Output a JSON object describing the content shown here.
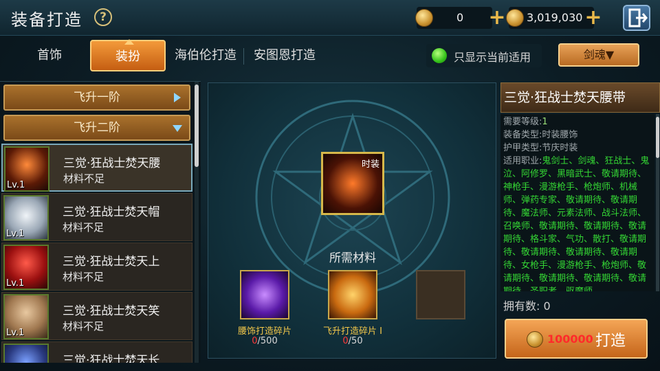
{
  "header": {
    "title": "装备打造",
    "currency1": "0",
    "currency2": "3,019,030"
  },
  "tabs": [
    "首饰",
    "装扮",
    "海伯伦打造",
    "安图恩打造"
  ],
  "filter": {
    "label": "只显示当前适用",
    "enabled": true
  },
  "class_select": "剑魂▼",
  "list": {
    "groups": [
      "飞升一阶",
      "飞升二阶"
    ],
    "items": [
      {
        "name": "三觉·狂战士焚天腰",
        "status": "材料不足",
        "lv": "Lv.1"
      },
      {
        "name": "三觉·狂战士焚天帽",
        "status": "材料不足",
        "lv": "Lv.1"
      },
      {
        "name": "三觉·狂战士焚天上",
        "status": "材料不足",
        "lv": "Lv.1"
      },
      {
        "name": "三觉·狂战士焚天笑",
        "status": "材料不足",
        "lv": "Lv.1"
      },
      {
        "name": "三觉·狂战士焚天长",
        "status": "",
        "lv": ""
      }
    ]
  },
  "center": {
    "result_tag": "时装",
    "req_label": "所需材料",
    "materials": [
      {
        "name": "腰饰打造碎片",
        "have": "0",
        "need": "/500"
      },
      {
        "name": "飞升打造碎片 I",
        "have": "0",
        "need": "/50"
      }
    ]
  },
  "info": {
    "title": "三觉·狂战士焚天腰带",
    "level_label": "需要等级:",
    "level_value": "1",
    "type_label": "装备类型:",
    "type_value": "时装腰饰",
    "armor_label": "护甲类型:",
    "armor_value": "节庆时装",
    "jobs_label": "适用职业:",
    "jobs_value": "鬼剑士、剑魂、狂战士、鬼泣、阿修罗、黑暗武士、敬请期待、神枪手、漫游枪手、枪炮师、机械师、弹药专家、敬请期待、敬请期待、魔法师、元素法师、战斗法师、召唤师、敬请期待、敬请期待、敬请期待、格斗家、气功、散打、敬请期待、敬请期待、敬请期待、敬请期待、女枪手、漫游枪手、枪炮师、敬请期待、敬请期待、敬请期待、敬请期待、圣职者、驱魔师",
    "owned_label": "拥有数:",
    "owned_value": "0",
    "craft_cost": "100000",
    "craft_label": "打造"
  }
}
